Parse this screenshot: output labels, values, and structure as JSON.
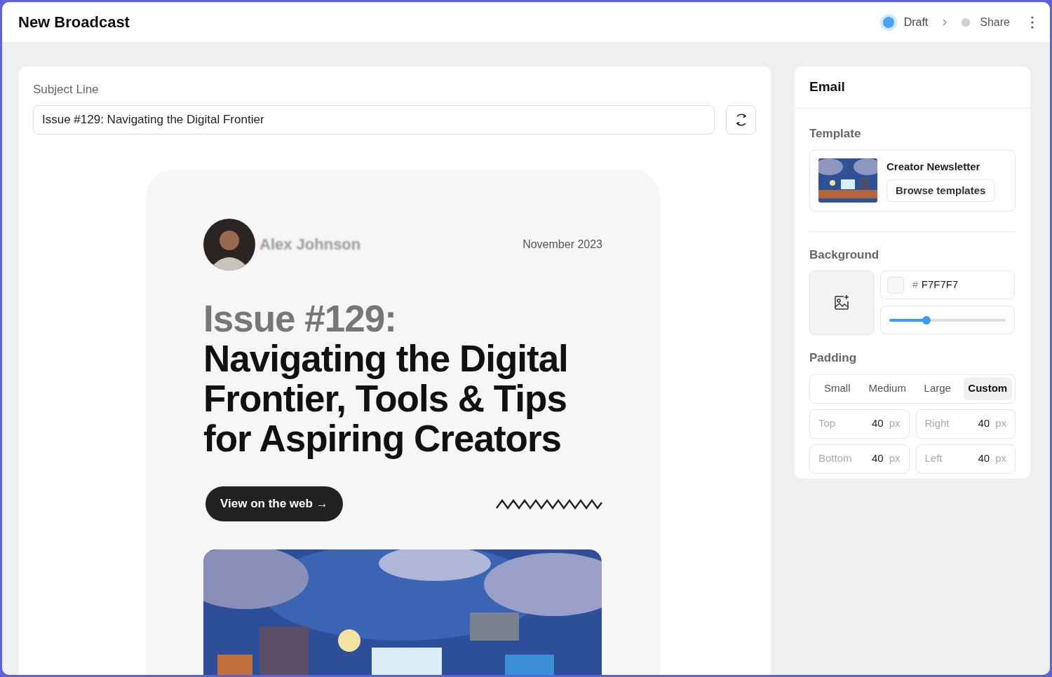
{
  "header": {
    "title": "New Broadcast",
    "steps": [
      {
        "label": "Draft",
        "selected": true
      },
      {
        "label": "Share",
        "selected": false
      }
    ]
  },
  "subject": {
    "label": "Subject Line",
    "value": "Issue #129: Navigating the Digital Frontier"
  },
  "preview": {
    "author": "Alex Johnson",
    "date": "November 2023",
    "title_lead": "Issue #129:",
    "title_rest": "Navigating the Digital Frontier, Tools & Tips for Aspiring Creators",
    "button": "View on the web →"
  },
  "sidebar": {
    "title": "Email",
    "template": {
      "label": "Template",
      "name": "Creator Newsletter",
      "button": "Browse templates"
    },
    "background": {
      "label": "Background",
      "hash": "#",
      "hex_value": "F7F7F7",
      "level": 0.32
    },
    "padding": {
      "label": "Padding",
      "presets": [
        {
          "label": "Small",
          "selected": false
        },
        {
          "label": "Medium",
          "selected": false
        },
        {
          "label": "Large",
          "selected": false
        },
        {
          "label": "Custom",
          "selected": true
        }
      ],
      "fields": [
        {
          "label": "Top",
          "value": "40",
          "unit": "px"
        },
        {
          "label": "Right",
          "value": "40",
          "unit": "px"
        },
        {
          "label": "Bottom",
          "value": "40",
          "unit": "px"
        },
        {
          "label": "Left",
          "value": "40",
          "unit": "px"
        }
      ]
    }
  }
}
